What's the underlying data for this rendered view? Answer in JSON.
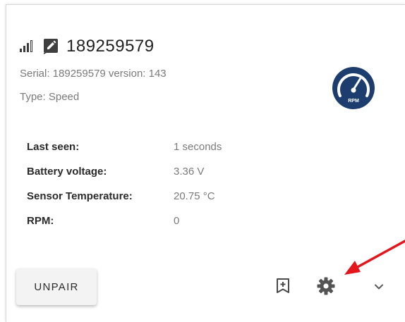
{
  "device": {
    "name": "189259579",
    "serial_line": "Serial: 189259579 version: 143",
    "type_line": "Type: Speed"
  },
  "badge": {
    "label": "RPM"
  },
  "info": [
    {
      "label": "Last seen:",
      "value": "1 seconds"
    },
    {
      "label": "Battery voltage:",
      "value": "3.36 V"
    },
    {
      "label": "Sensor Temperature:",
      "value": "20.75 °C"
    },
    {
      "label": "RPM:",
      "value": "0"
    }
  ],
  "actions": {
    "unpair_label": "UNPAIR"
  },
  "icons": {
    "signal": "signal-strength-icon",
    "edit": "edit-icon",
    "badge": "speedometer-rpm-icon",
    "bookmark": "bookmark-add-icon",
    "settings": "gear-icon",
    "expand": "chevron-down-icon"
  },
  "colors": {
    "badge": "#1c3d6e",
    "annotation_arrow": "#e4161b",
    "text_primary": "#212121",
    "text_secondary": "#7a7a7a"
  }
}
